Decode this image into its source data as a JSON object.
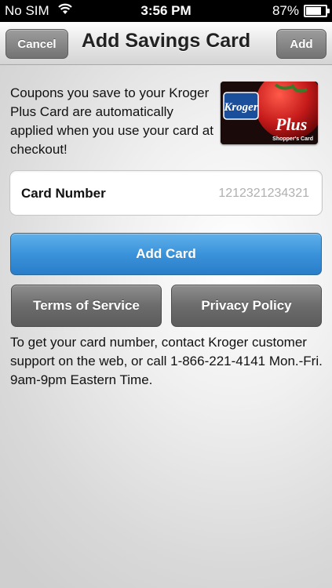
{
  "status_bar": {
    "carrier": "No SIM",
    "time": "3:56 PM",
    "battery_percent": "87%",
    "battery_level": 0.87,
    "icons": [
      "wifi-icon",
      "battery-icon"
    ]
  },
  "nav": {
    "cancel_label": "Cancel",
    "title": "Add Savings Card",
    "add_label": "Add"
  },
  "intro_text": "Coupons you save to your Kroger Plus Card are automatically applied when you use your card at checkout!",
  "card_image": {
    "brand": "Kroger",
    "script": "Plus",
    "subtitle": "Shopper's Card"
  },
  "card_field": {
    "label": "Card Number",
    "placeholder": "1212321234321",
    "value": ""
  },
  "buttons": {
    "add_card": "Add Card",
    "terms": "Terms of Service",
    "privacy": "Privacy Policy"
  },
  "footer_text": "To get your card number, contact Kroger customer support on the web, or call 1-866-221-4141 Mon.-Fri. 9am-9pm Eastern Time.",
  "colors": {
    "accent_blue": "#3a93da",
    "gray_button": "#6c6c6c",
    "kroger_blue": "#1b4f9c",
    "card_red": "#c41a1a"
  }
}
